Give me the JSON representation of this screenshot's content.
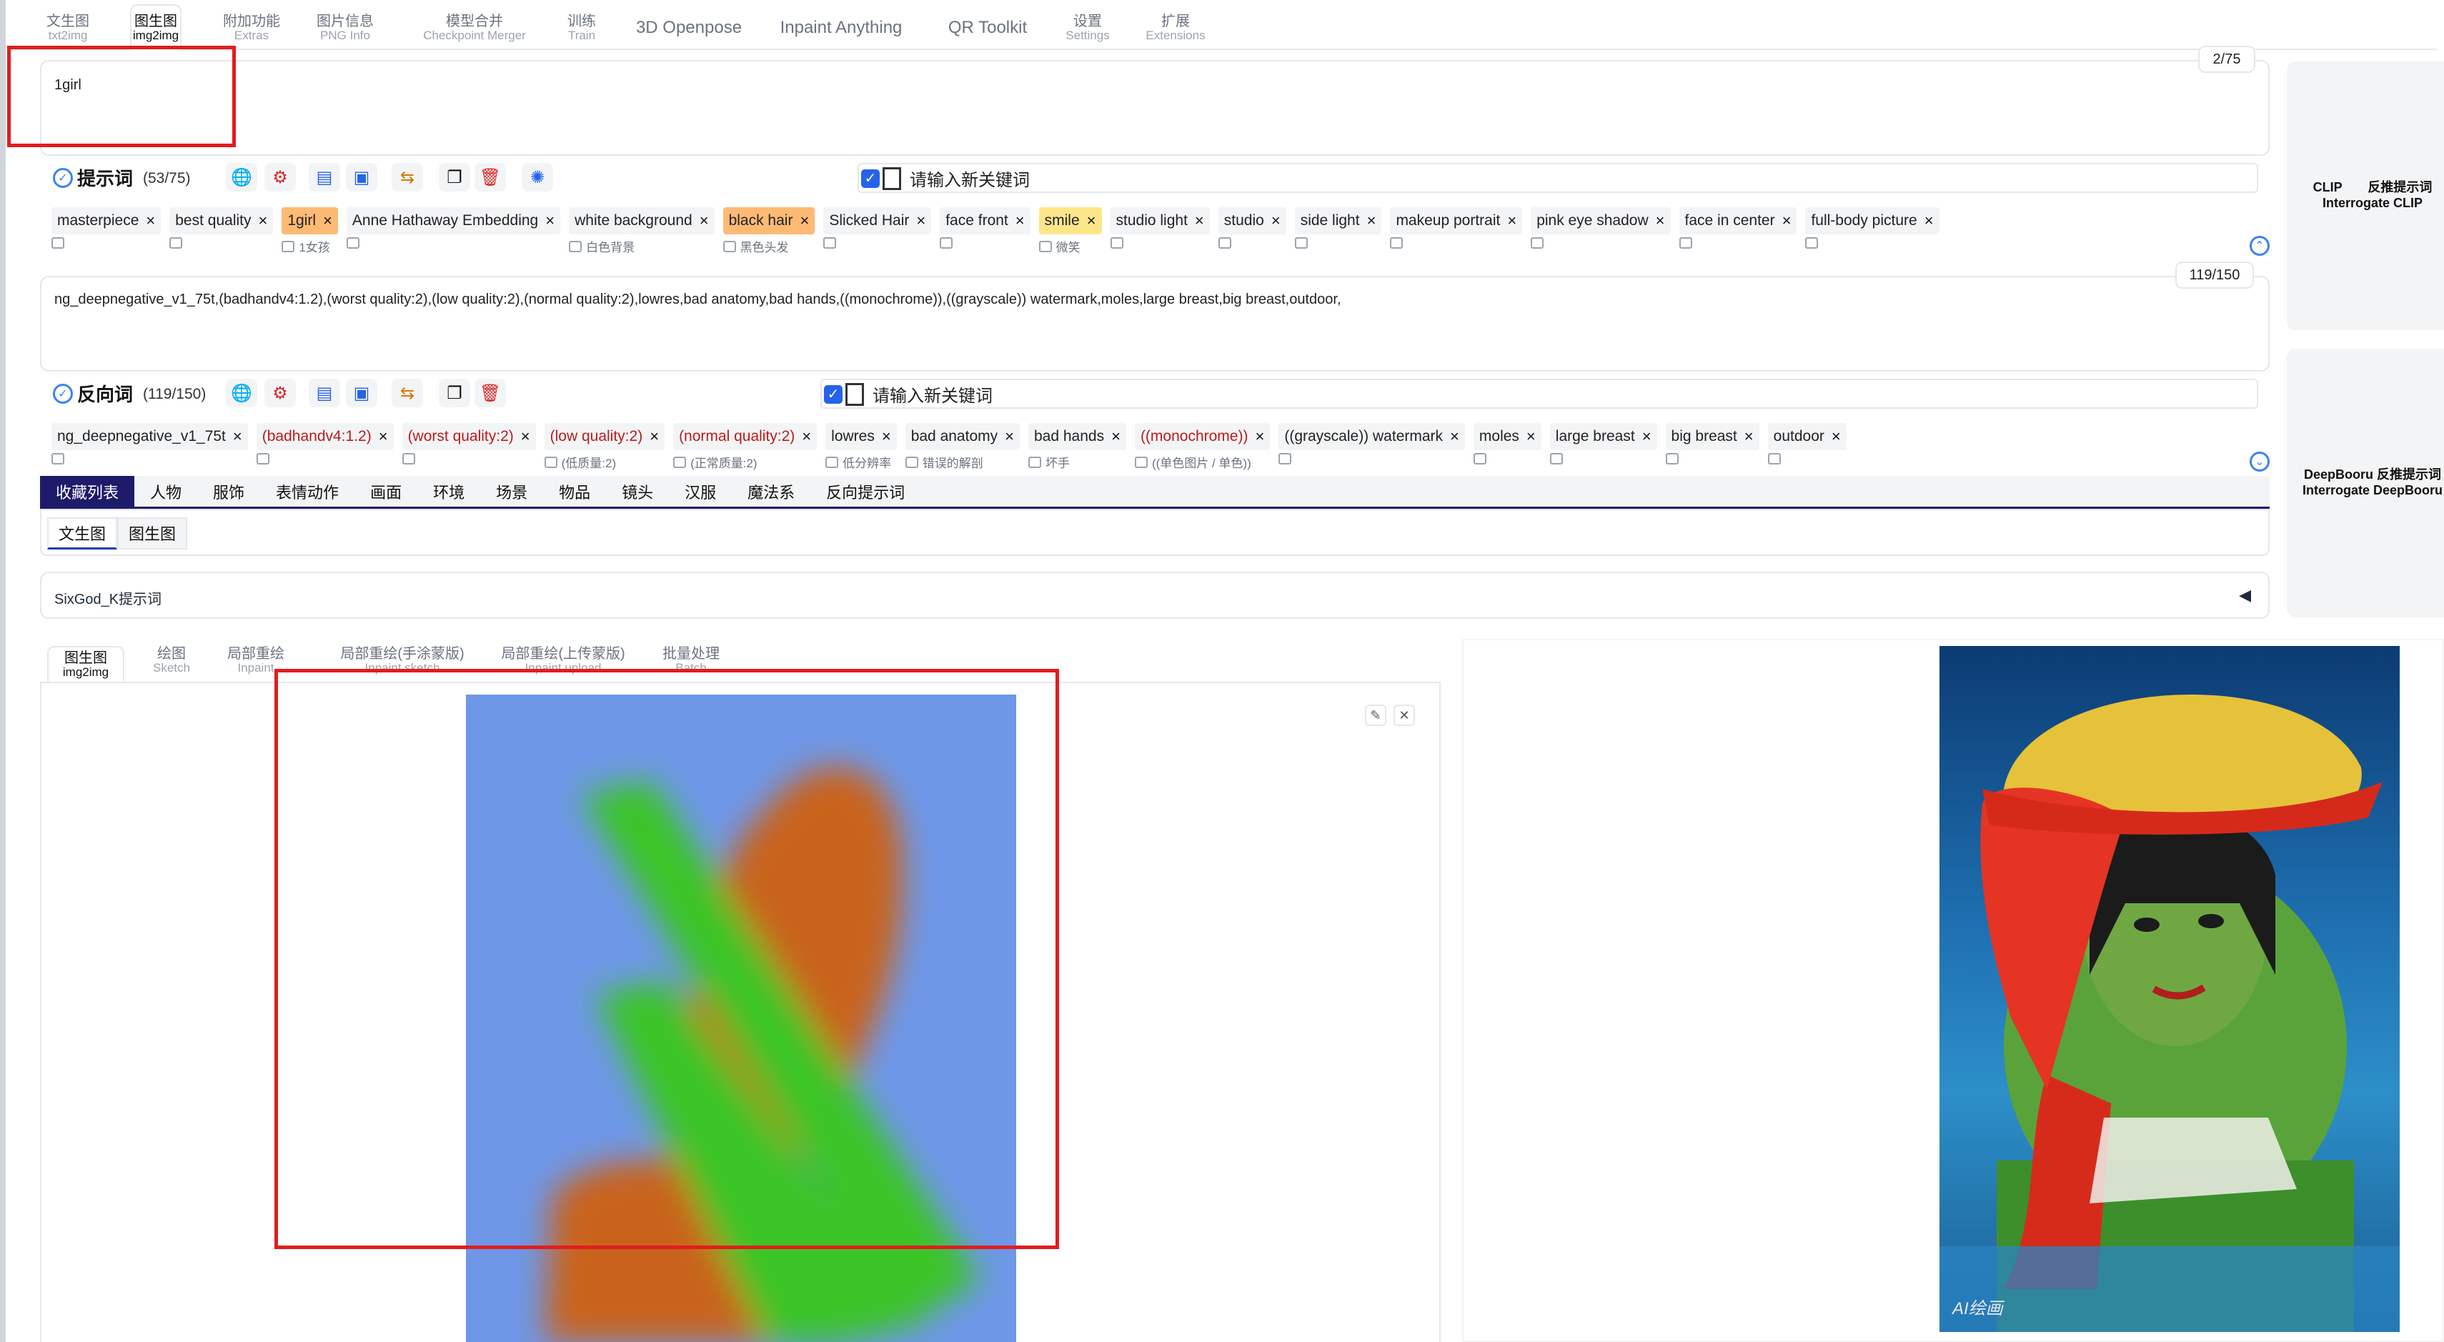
{
  "top_tabs": [
    {
      "label": "文生图",
      "sub": "txt2img"
    },
    {
      "label": "图生图",
      "sub": "img2img"
    },
    {
      "label": "附加功能",
      "sub": "Extras"
    },
    {
      "label": "图片信息",
      "sub": "PNG Info"
    },
    {
      "label": "模型合并",
      "sub": "Checkpoint Merger"
    },
    {
      "label": "训练",
      "sub": "Train"
    },
    {
      "label": "3D Openpose",
      "sub": ""
    },
    {
      "label": "Inpaint Anything",
      "sub": ""
    },
    {
      "label": "QR Toolkit",
      "sub": ""
    },
    {
      "label": "设置",
      "sub": "Settings"
    },
    {
      "label": "扩展",
      "sub": "Extensions"
    }
  ],
  "prompt": {
    "text": "1girl",
    "counter": "2/75",
    "label": "提示词",
    "count": "(53/75)",
    "keyword_placeholder": "请输入新关键词",
    "tags": [
      {
        "text": "masterpiece",
        "sub": "",
        "style": ""
      },
      {
        "text": "best quality",
        "sub": "",
        "style": ""
      },
      {
        "text": "1girl",
        "sub": "1女孩",
        "style": "orange"
      },
      {
        "text": "Anne Hathaway Embedding",
        "sub": "",
        "style": ""
      },
      {
        "text": "white background",
        "sub": "白色背景",
        "style": ""
      },
      {
        "text": "black hair",
        "sub": "黑色头发",
        "style": "orange"
      },
      {
        "text": "Slicked Hair",
        "sub": "",
        "style": ""
      },
      {
        "text": "face front",
        "sub": "",
        "style": ""
      },
      {
        "text": "smile",
        "sub": "微笑",
        "style": "yellow"
      },
      {
        "text": "studio light",
        "sub": "",
        "style": ""
      },
      {
        "text": "studio",
        "sub": "",
        "style": ""
      },
      {
        "text": "side light",
        "sub": "",
        "style": ""
      },
      {
        "text": "makeup portrait",
        "sub": "",
        "style": ""
      },
      {
        "text": "pink eye shadow",
        "sub": "",
        "style": ""
      },
      {
        "text": "face in center",
        "sub": "",
        "style": ""
      },
      {
        "text": "full-body picture",
        "sub": "",
        "style": ""
      }
    ]
  },
  "negative": {
    "text": "ng_deepnegative_v1_75t,(badhandv4:1.2),(worst quality:2),(low quality:2),(normal quality:2),lowres,bad anatomy,bad hands,((monochrome)),((grayscale)) watermark,moles,large breast,big breast,outdoor,",
    "counter": "119/150",
    "label": "反向词",
    "count": "(119/150)",
    "keyword_placeholder": "请输入新关键词",
    "tags": [
      {
        "text": "ng_deepnegative_v1_75t",
        "sub": "",
        "style": ""
      },
      {
        "text": "(badhandv4:1.2)",
        "sub": "",
        "style": "red"
      },
      {
        "text": "(worst quality:2)",
        "sub": "",
        "style": "red"
      },
      {
        "text": "(low quality:2)",
        "sub": "(低质量:2)",
        "style": "red"
      },
      {
        "text": "(normal quality:2)",
        "sub": "(正常质量:2)",
        "style": "red"
      },
      {
        "text": "lowres",
        "sub": "低分辨率",
        "style": ""
      },
      {
        "text": "bad anatomy",
        "sub": "错误的解剖",
        "style": ""
      },
      {
        "text": "bad hands",
        "sub": "坏手",
        "style": ""
      },
      {
        "text": "((monochrome))",
        "sub": "((单色图片 / 单色))",
        "style": "red"
      },
      {
        "text": "((grayscale)) watermark",
        "sub": "",
        "style": ""
      },
      {
        "text": "moles",
        "sub": "",
        "style": ""
      },
      {
        "text": "large breast",
        "sub": "",
        "style": ""
      },
      {
        "text": "big breast",
        "sub": "",
        "style": ""
      },
      {
        "text": "outdoor",
        "sub": "",
        "style": ""
      }
    ]
  },
  "categories": [
    "收藏列表",
    "人物",
    "服饰",
    "表情动作",
    "画面",
    "环境",
    "场景",
    "物品",
    "镜头",
    "汉服",
    "魔法系",
    "反向提示词"
  ],
  "sub_tabs": [
    "文生图",
    "图生图"
  ],
  "sixgod": "SixGod_K提示词",
  "img_tabs": [
    {
      "label": "图生图",
      "sub": "img2img"
    },
    {
      "label": "绘图",
      "sub": "Sketch"
    },
    {
      "label": "局部重绘",
      "sub": "Inpaint"
    },
    {
      "label": "局部重绘(手涂蒙版)",
      "sub": "Inpaint sketch"
    },
    {
      "label": "局部重绘(上传蒙版)",
      "sub": "Inpaint upload"
    },
    {
      "label": "批量处理",
      "sub": "Batch"
    }
  ],
  "side": {
    "clip": "CLIP　　反推提示词",
    "clip_sub": "Interrogate CLIP",
    "deepbooru": "DeepBooru 反推提示词",
    "deepbooru_sub": "Interrogate DeepBooru"
  },
  "result_watermark": "AI绘画",
  "colors": {
    "accent": "#1e1b6b",
    "highlight": "#fdba74",
    "smile": "#fde68a",
    "red_outline": "#e11d1d"
  }
}
